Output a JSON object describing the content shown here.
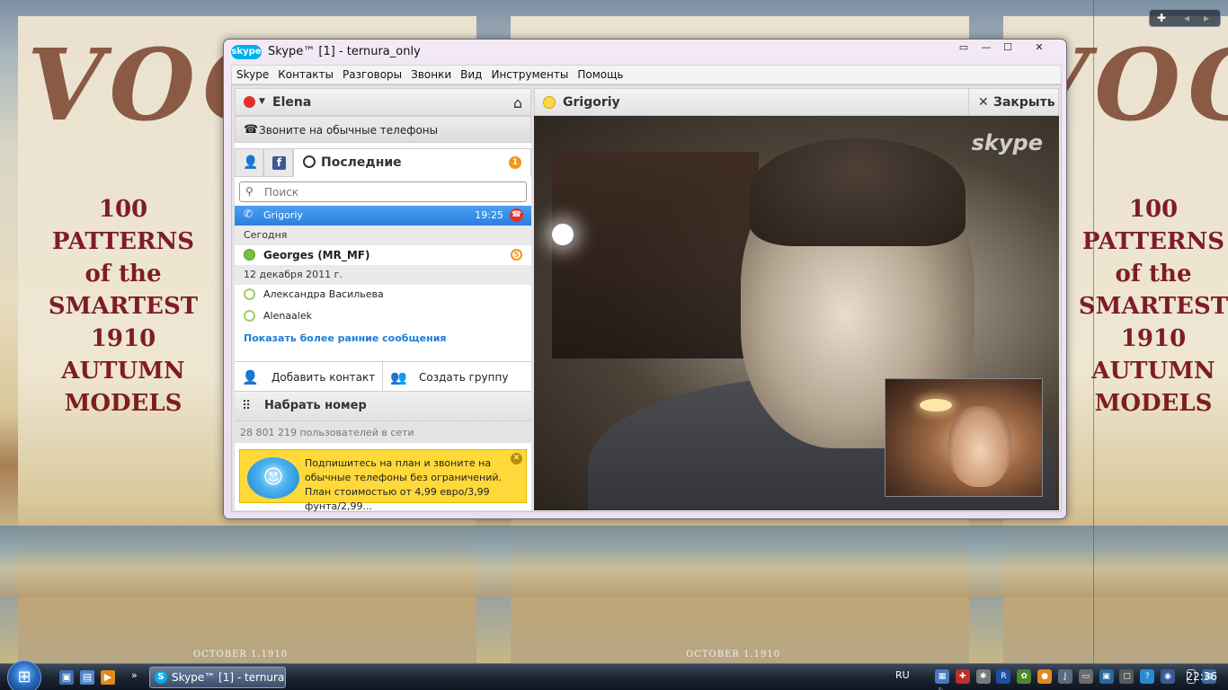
{
  "window": {
    "title": "Skype™ [1] - ternura_only",
    "logo": "skype",
    "controls": [
      "restore-icon",
      "minimize-icon",
      "maximize-icon",
      "close-icon"
    ]
  },
  "menu": [
    "Skype",
    "Контакты",
    "Разговоры",
    "Звонки",
    "Вид",
    "Инструменты",
    "Помощь"
  ],
  "profile": {
    "name": "Elena",
    "status_color": "#e0312a"
  },
  "call_phones": "Звоните на обычные телефоны",
  "tabs": {
    "recent_label": "Последние",
    "recent_badge": "1"
  },
  "search": {
    "placeholder": "Поиск",
    "value": ""
  },
  "recent": {
    "active": {
      "name": "Grigoriy",
      "time": "19:25"
    },
    "today_label": "Сегодня",
    "today": [
      {
        "name": "Georges (MR_MF)",
        "badge": "5"
      }
    ],
    "date_label": "12 декабря 2011 г.",
    "older": [
      {
        "name": "Александра Васильева"
      },
      {
        "name": "Alenaalek"
      }
    ],
    "more_link": "Показать более ранние сообщения"
  },
  "actions": {
    "add_contact": "Добавить контакт",
    "create_group": "Создать группу",
    "dial": "Набрать номер"
  },
  "online_count": "28 801 219 пользователей в сети",
  "promo": {
    "text": "Подпишитесь на план и звоните на обычные телефоны без ограничений. План стоимостью от 4,99 евро/3,99 фунта/2,99..."
  },
  "call": {
    "contact": "Grigoriy",
    "close_label": "Закрыть",
    "watermark": "skype"
  },
  "wallpaper": {
    "title_letters": "VOG",
    "lines": [
      "100",
      "PATTERNS",
      "of the",
      "SMARTEST",
      "1910",
      "AUTUMN",
      "MODELS"
    ],
    "date": "OCTOBER 1.1910"
  },
  "taskbar": {
    "task_title": "Skype™ [1] - ternura...",
    "lang": "RU",
    "time": "22:36"
  },
  "colors": {
    "skype_blue": "#00aff0",
    "selection_blue": "#2a7fde",
    "promo_yellow": "#ffd93a",
    "link_blue": "#1e7fd6",
    "badge_orange": "#f39617"
  }
}
